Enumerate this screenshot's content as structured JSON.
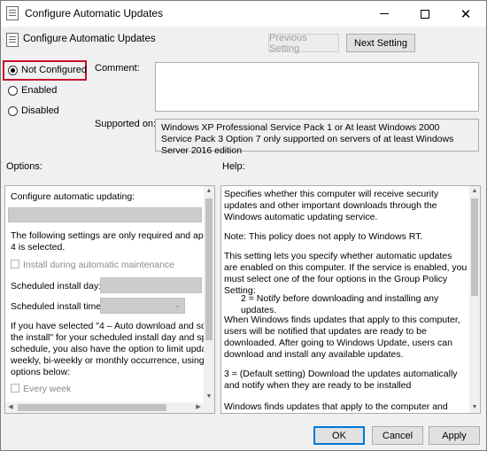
{
  "window": {
    "title": "Configure Automatic Updates",
    "controls": {
      "minimize": "—",
      "maximize": "☐",
      "close": "✕"
    }
  },
  "header": {
    "policy_name": "Configure Automatic Updates",
    "previous_setting": "Previous Setting",
    "next_setting": "Next Setting"
  },
  "state": {
    "options": [
      "Not Configured",
      "Enabled",
      "Disabled"
    ],
    "selected": "Not Configured"
  },
  "comment": {
    "label": "Comment:",
    "value": ""
  },
  "supported_on": {
    "label": "Supported on:",
    "text": "Windows XP Professional Service Pack 1 or At least Windows 2000 Service Pack 3 Option 7 only supported on servers of at least Windows Server 2016 edition"
  },
  "options_panel": {
    "label": "Options:",
    "configure_label": "Configure automatic updating:",
    "note_lines": [
      "The following settings are only required and applical",
      "4 is selected."
    ],
    "install_maintenance": "Install during automatic maintenance",
    "scheduled_day": "Scheduled install day:",
    "scheduled_time": "Scheduled install time:",
    "info_lines": [
      "If you have selected \"4 – Auto download and sched",
      "the install\" for your scheduled install day and specifi",
      "schedule, you also have the option to limit updating",
      "weekly, bi-weekly or monthly occurrence, using the",
      "options below:"
    ],
    "every_week": "Every week"
  },
  "help_panel": {
    "label": "Help:",
    "paragraphs": [
      "Specifies whether this computer will receive security updates and other important downloads through the Windows automatic updating service.",
      "Note: This policy does not apply to Windows RT.",
      "This setting lets you specify whether automatic updates are enabled on this computer. If the service is enabled, you must select one of the four options in the Group Policy Setting:",
      "2 = Notify before downloading and installing any updates.",
      "When Windows finds updates that apply to this computer, users will be notified that updates are ready to be downloaded. After going to Windows Update, users can download and install any available updates.",
      "3 = (Default setting) Download the updates automatically and notify when they are ready to be installed",
      "Windows finds updates that apply to the computer and"
    ]
  },
  "footer": {
    "ok": "OK",
    "cancel": "Cancel",
    "apply": "Apply"
  },
  "colors": {
    "highlight": "#c8102e",
    "focus": "#0078d7",
    "dialog_bg": "#f0f0f0"
  },
  "icons": [
    "policy-icon",
    "radio-selected-icon",
    "checkbox-icon",
    "dropdown-icon",
    "scroll-arrow-icon"
  ]
}
